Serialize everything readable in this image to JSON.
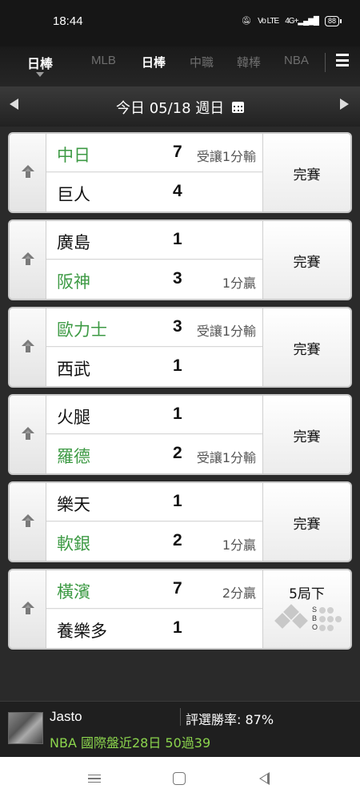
{
  "status_bar": {
    "time": "18:44",
    "icons": [
      "mute-icon",
      "volte-icon",
      "signal-4g-icon",
      "battery-icon"
    ],
    "volte": "Vo LTE",
    "network": "4G+",
    "battery": "88"
  },
  "league_bar": {
    "current": "日棒",
    "tabs": [
      {
        "label": "MLB",
        "active": false
      },
      {
        "label": "日棒",
        "active": true
      },
      {
        "label": "中職",
        "active": false
      },
      {
        "label": "韓棒",
        "active": false
      },
      {
        "label": "NBA",
        "active": false
      }
    ]
  },
  "date_bar": {
    "label": "今日 05/18 週日"
  },
  "games": [
    {
      "home": {
        "name": "中日",
        "score": "7",
        "note": "受讓1分輸",
        "favored": true
      },
      "away": {
        "name": "巨人",
        "score": "4",
        "note": "",
        "favored": false
      },
      "status": "完賽"
    },
    {
      "home": {
        "name": "廣島",
        "score": "1",
        "note": "",
        "favored": false
      },
      "away": {
        "name": "阪神",
        "score": "3",
        "note": "1分贏",
        "favored": true
      },
      "status": "完賽"
    },
    {
      "home": {
        "name": "歐力士",
        "score": "3",
        "note": "受讓1分輸",
        "favored": true
      },
      "away": {
        "name": "西武",
        "score": "1",
        "note": "",
        "favored": false
      },
      "status": "完賽"
    },
    {
      "home": {
        "name": "火腿",
        "score": "1",
        "note": "",
        "favored": false
      },
      "away": {
        "name": "羅德",
        "score": "2",
        "note": "受讓1分輸",
        "favored": true
      },
      "status": "完賽"
    },
    {
      "home": {
        "name": "樂天",
        "score": "1",
        "note": "",
        "favored": false
      },
      "away": {
        "name": "軟銀",
        "score": "2",
        "note": "1分贏",
        "favored": true
      },
      "status": "完賽"
    },
    {
      "home": {
        "name": "橫濱",
        "score": "7",
        "note": "2分贏",
        "favored": true
      },
      "away": {
        "name": "養樂多",
        "score": "1",
        "note": "",
        "favored": false
      },
      "status": "5局下",
      "sbo": {
        "S": "S",
        "B": "B",
        "O": "O",
        "strikes": 0,
        "balls": 0,
        "outs": 0
      }
    }
  ],
  "tipster": {
    "name": "Jasto",
    "win_rate": "評選勝率: 87%",
    "record": "NBA 國際盤近28日 50過39"
  },
  "colors": {
    "favored_team": "#3d9a44",
    "record_text": "#8bd44d"
  }
}
